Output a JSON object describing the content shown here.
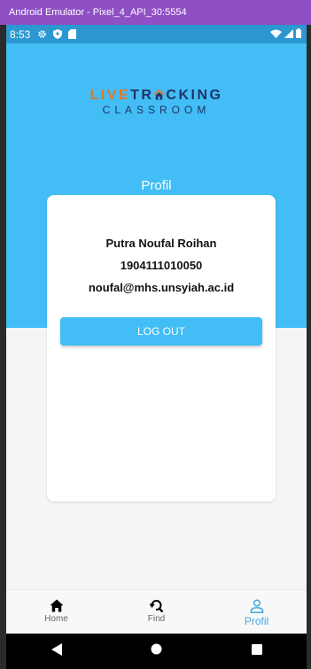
{
  "window": {
    "title": "Android Emulator - Pixel_4_API_30:5554"
  },
  "status_bar": {
    "time": "8:53"
  },
  "logo": {
    "top_left": "LIVE",
    "top_right": "TR",
    "top_rest": "CKING",
    "bottom": "CLASSROOM"
  },
  "page": {
    "heading": "Profil"
  },
  "profile": {
    "name": "Putra Noufal Roihan",
    "id_number": "1904111010050",
    "email": "noufal@mhs.unsyiah.ac.id"
  },
  "actions": {
    "logout_label": "LOG OUT"
  },
  "bottom_nav": {
    "items": [
      {
        "label": "Home",
        "icon": "home-icon"
      },
      {
        "label": "Find",
        "icon": "find-icon"
      },
      {
        "label": "Profil",
        "icon": "person-icon",
        "active": true
      }
    ]
  },
  "colors": {
    "primary": "#42bdf5",
    "status_bar": "#2c97d0",
    "window_bar": "#8f4fc5",
    "logo_dark": "#213466",
    "logo_accent": "#e0772d"
  }
}
